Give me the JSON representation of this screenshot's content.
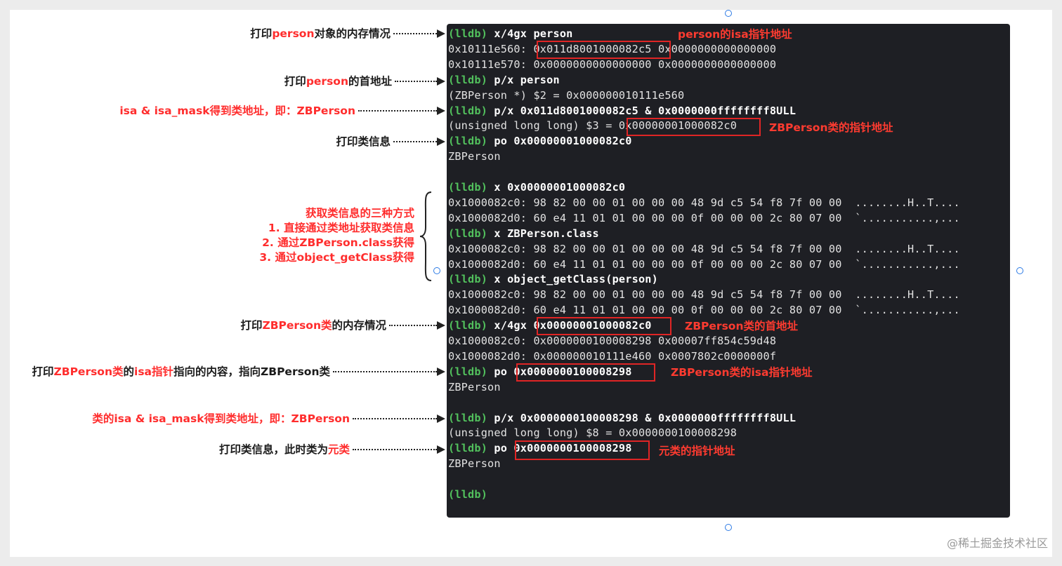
{
  "terminal": {
    "lines": [
      {
        "prompt": "(lldb)",
        "cmd": " x/4gx person"
      },
      {
        "text": "0x10111e560: 0x011d8001000082c5 0x0000000000000000"
      },
      {
        "text": "0x10111e570: 0x0000000000000000 0x0000000000000000"
      },
      {
        "prompt": "(lldb)",
        "cmd": " p/x person"
      },
      {
        "text": "(ZBPerson *) $2 = 0x000000010111e560"
      },
      {
        "prompt": "(lldb)",
        "cmd": " p/x 0x011d8001000082c5 & 0x0000000ffffffff8ULL"
      },
      {
        "text": "(unsigned long long) $3 = 0x00000001000082c0"
      },
      {
        "prompt": "(lldb)",
        "cmd": " po 0x00000001000082c0"
      },
      {
        "text": "ZBPerson"
      },
      {
        "text": ""
      },
      {
        "prompt": "(lldb)",
        "cmd": " x 0x00000001000082c0"
      },
      {
        "text": "0x1000082c0: 98 82 00 00 01 00 00 00 48 9d c5 54 f8 7f 00 00  ........H..T...."
      },
      {
        "text": "0x1000082d0: 60 e4 11 01 01 00 00 00 0f 00 00 00 2c 80 07 00  `...........,..."
      },
      {
        "prompt": "(lldb)",
        "cmd": " x ZBPerson.class"
      },
      {
        "text": "0x1000082c0: 98 82 00 00 01 00 00 00 48 9d c5 54 f8 7f 00 00  ........H..T...."
      },
      {
        "text": "0x1000082d0: 60 e4 11 01 01 00 00 00 0f 00 00 00 2c 80 07 00  `...........,..."
      },
      {
        "prompt": "(lldb)",
        "cmd": " x object_getClass(person)"
      },
      {
        "text": "0x1000082c0: 98 82 00 00 01 00 00 00 48 9d c5 54 f8 7f 00 00  ........H..T...."
      },
      {
        "text": "0x1000082d0: 60 e4 11 01 01 00 00 00 0f 00 00 00 2c 80 07 00  `...........,..."
      },
      {
        "prompt": "(lldb)",
        "cmd": " x/4gx 0x00000001000082c0"
      },
      {
        "text": "0x1000082c0: 0x0000000100008298 0x00007ff854c59d48"
      },
      {
        "text": "0x1000082d0: 0x000000010111e460 0x0007802c0000000f"
      },
      {
        "prompt": "(lldb)",
        "cmd": " po 0x0000000100008298"
      },
      {
        "text": "ZBPerson"
      },
      {
        "text": ""
      },
      {
        "prompt": "(lldb)",
        "cmd": " p/x 0x0000000100008298 & 0x0000000ffffffff8ULL"
      },
      {
        "text": "(unsigned long long) $8 = 0x0000000100008298"
      },
      {
        "prompt": "(lldb)",
        "cmd": " po 0x0000000100008298"
      },
      {
        "text": "ZBPerson"
      },
      {
        "text": ""
      },
      {
        "prompt": "(lldb)",
        "cmd": ""
      }
    ],
    "notes": [
      "person的isa指针地址",
      "ZBPerson类的指针地址",
      "ZBPerson类的首地址",
      "ZBPerson类的isa指针地址",
      "元类的指针地址"
    ]
  },
  "annotations": [
    {
      "parts": [
        {
          "t": "打印",
          "red": false
        },
        {
          "t": "person",
          "red": true
        },
        {
          "t": "对象的内存情况",
          "red": false
        }
      ]
    },
    {
      "parts": [
        {
          "t": "打印",
          "red": false
        },
        {
          "t": "person",
          "red": true
        },
        {
          "t": "的首地址",
          "red": false
        }
      ]
    },
    {
      "parts": [
        {
          "t": "isa & isa_mask得到类地址，即：ZBPerson",
          "red": true
        }
      ]
    },
    {
      "parts": [
        {
          "t": "打印类信息",
          "red": false
        }
      ]
    },
    {
      "parts": [
        {
          "t": "打印",
          "red": false
        },
        {
          "t": "ZBPerson类",
          "red": true
        },
        {
          "t": "的内存情况",
          "red": false
        }
      ]
    },
    {
      "parts": [
        {
          "t": "打印",
          "red": false
        },
        {
          "t": "ZBPerson类",
          "red": true
        },
        {
          "t": "的",
          "red": false
        },
        {
          "t": "isa指针",
          "red": true
        },
        {
          "t": "指向的内容，指向ZBPerson类",
          "red": false
        }
      ]
    },
    {
      "parts": [
        {
          "t": "类的isa & isa_mask得到类地址，即：ZBPerson",
          "red": true
        }
      ]
    },
    {
      "parts": [
        {
          "t": "打印类信息，此时类为",
          "red": false
        },
        {
          "t": "元类",
          "red": true
        }
      ]
    }
  ],
  "methods": {
    "title": "获取类信息的三种方式",
    "items": [
      "1.  直接通过类地址获取类信息",
      "2. 通过ZBPerson.class获得",
      "3. 通过object_getClass获得"
    ]
  },
  "watermark": "@稀土掘金技术社区",
  "colors": {
    "prompt": "#52c15d",
    "annotation_red": "#ff2d2d",
    "terminal_bg": "#1e1f24"
  }
}
